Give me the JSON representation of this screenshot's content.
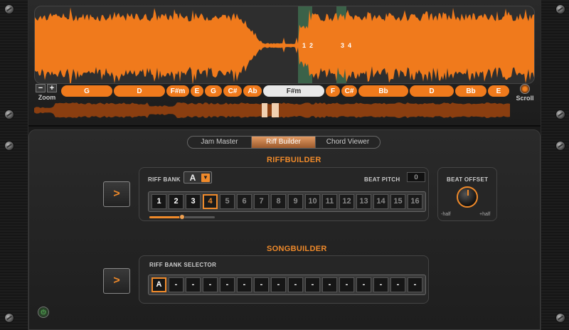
{
  "waveform": {
    "markers": [
      "1",
      "2",
      "3",
      "4"
    ],
    "colors": {
      "wave": "#f07a1c",
      "loop": "#3d6b4d",
      "background": "#2e2e2e"
    }
  },
  "controls": {
    "zoom_label": "Zoom",
    "zoom_minus": "−",
    "zoom_plus": "+",
    "scroll_label": "Scroll"
  },
  "chords": [
    {
      "name": "G",
      "width_hint": "wide"
    },
    {
      "name": "D",
      "width_hint": "wide"
    },
    {
      "name": "F#m"
    },
    {
      "name": "E"
    },
    {
      "name": "G"
    },
    {
      "name": "C#"
    },
    {
      "name": "Ab"
    },
    {
      "name": "F#m",
      "selected": true
    },
    {
      "name": "F"
    },
    {
      "name": "C#"
    },
    {
      "name": "Bb"
    },
    {
      "name": "D"
    },
    {
      "name": "Bb"
    },
    {
      "name": "E"
    }
  ],
  "tabs": [
    {
      "label": "Jam Master",
      "active": false
    },
    {
      "label": "Riff Builder",
      "active": true
    },
    {
      "label": "Chord Viewer",
      "active": false
    }
  ],
  "riffbuilder": {
    "title": "RIFFBUILDER",
    "play_label": ">",
    "riff_bank_label": "RIFF BANK",
    "riff_bank_value": "A",
    "riff_bank_arrow": "▼",
    "beat_pitch_label": "BEAT PITCH",
    "beat_pitch_value": "0",
    "slots": [
      "1",
      "2",
      "3",
      "4",
      "5",
      "6",
      "7",
      "8",
      "9",
      "10",
      "11",
      "12",
      "13",
      "14",
      "15",
      "16"
    ],
    "active_count": 4,
    "selected_slot": 4,
    "slider_level": 0.5
  },
  "beat_offset": {
    "label": "BEAT OFFSET",
    "min_label": "-half",
    "max_label": "+half"
  },
  "songbuilder": {
    "title": "SONGBUILDER",
    "play_label": ">",
    "selector_label": "RIFF BANK SELECTOR",
    "slots": [
      "A",
      "-",
      "-",
      "-",
      "-",
      "-",
      "-",
      "-",
      "-",
      "-",
      "-",
      "-",
      "-",
      "-",
      "-",
      "-"
    ],
    "selected_slot": 1
  },
  "power_icon": "power-icon"
}
